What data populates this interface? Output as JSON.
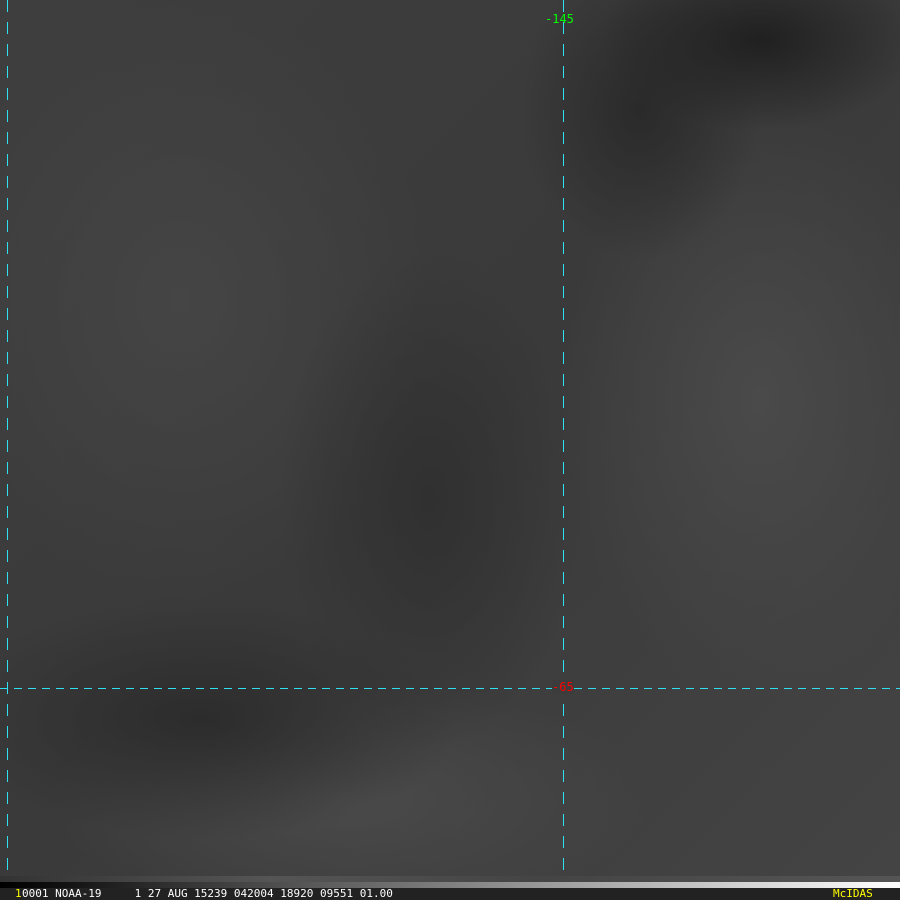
{
  "grid_labels": {
    "longitude": "-145",
    "latitude": "-65"
  },
  "status": {
    "frame": "1",
    "info": "0001 NOAA-19     1 27 AUG 15239 042004 18920 09551 01.00",
    "brand": "McIDAS"
  },
  "colors": {
    "grid": "#30e0f0",
    "lon_label": "#00ff00",
    "lat_label": "#ff0000",
    "brand": "#ffff00"
  }
}
